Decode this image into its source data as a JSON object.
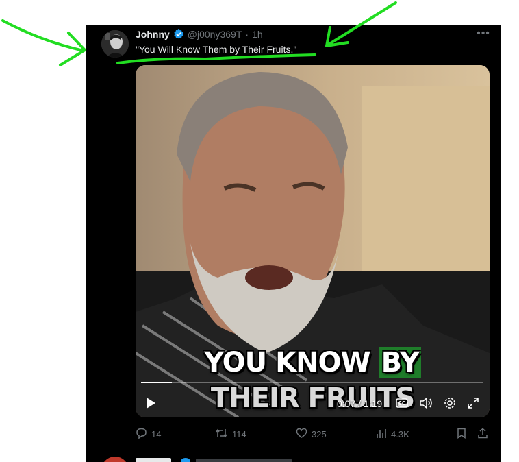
{
  "tweet": {
    "author_name": "Johnny",
    "handle": "@j00ny369T",
    "separator": "·",
    "time_ago": "1h",
    "text": "\"You Will Know Them by Their Fruits.\"",
    "more_label": "•••"
  },
  "video": {
    "caption_line1_a": "YOU KNOW ",
    "caption_line1_b": "BY",
    "caption_line2": "THEIR FRUITS",
    "current_time": "0:07",
    "duration": "1:19",
    "time_display": "0:07 / 1:19",
    "progress_fraction": 0.089
  },
  "actions": {
    "replies": "14",
    "reposts": "114",
    "likes": "325",
    "views": "4.3K"
  },
  "colors": {
    "background": "#000000",
    "annotation": "#22dd22",
    "verified": "#1d9bf0",
    "caption_highlight": "#1f7d2a",
    "muted_text": "#71767b"
  },
  "icons": [
    "verified-badge-icon",
    "more-icon",
    "play-icon",
    "closed-captions-icon",
    "volume-icon",
    "settings-icon",
    "fullscreen-icon",
    "reply-icon",
    "repost-icon",
    "like-icon",
    "views-icon",
    "bookmark-icon",
    "share-icon"
  ]
}
